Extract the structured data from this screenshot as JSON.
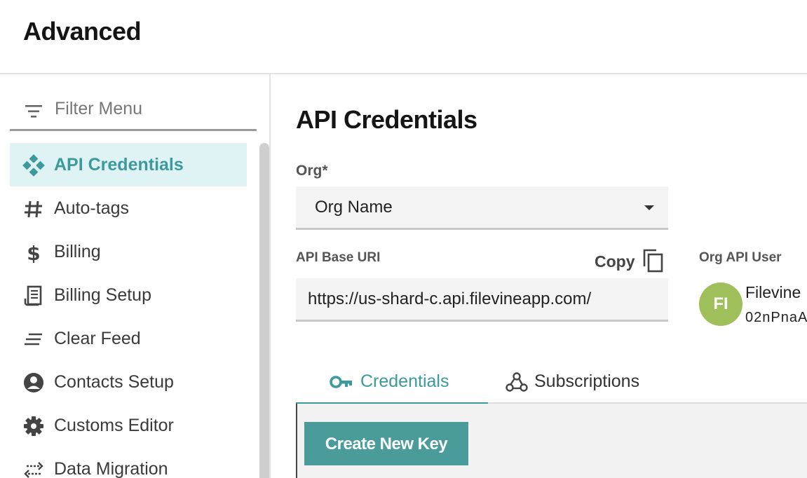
{
  "header": {
    "title": "Advanced"
  },
  "sidebar": {
    "filter_placeholder": "Filter Menu",
    "items": [
      {
        "label": "API Credentials",
        "icon": "api-diamond-icon",
        "active": true
      },
      {
        "label": "Auto-tags",
        "icon": "hashtag-icon"
      },
      {
        "label": "Billing",
        "icon": "dollar-icon"
      },
      {
        "label": "Billing Setup",
        "icon": "receipt-icon"
      },
      {
        "label": "Clear Feed",
        "icon": "clear-lines-icon"
      },
      {
        "label": "Contacts Setup",
        "icon": "person-circle-icon"
      },
      {
        "label": "Customs Editor",
        "icon": "gear-icon"
      },
      {
        "label": "Data Migration",
        "icon": "transfer-arrows-icon"
      }
    ]
  },
  "main": {
    "title": "API Credentials",
    "org": {
      "label": "Org*",
      "value": "Org Name"
    },
    "api_base_uri": {
      "label": "API Base URI",
      "copy_label": "Copy",
      "value": "https://us-shard-c.api.filevineapp.com/"
    },
    "org_api_user": {
      "label": "Org API User",
      "initials": "FI",
      "name": "Filevine",
      "id": "02nPnaA"
    },
    "tabs": [
      {
        "label": "Credentials",
        "icon": "key-icon",
        "active": true
      },
      {
        "label": "Subscriptions",
        "icon": "webhook-icon"
      }
    ],
    "create_button": "Create New Key"
  },
  "colors": {
    "accent": "#3d9a9c",
    "active_bg": "#dff3f4",
    "button": "#4a9c9b",
    "avatar": "#9fbf5b"
  }
}
